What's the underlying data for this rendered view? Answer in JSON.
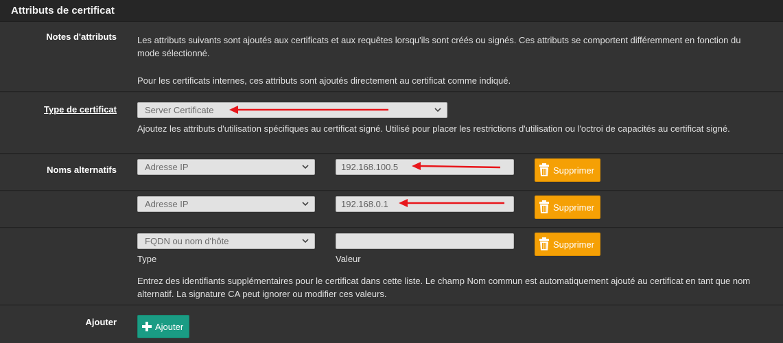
{
  "panel": {
    "title": "Attributs de certificat"
  },
  "notes": {
    "label": "Notes d'attributs",
    "text1": "Les attributs suivants sont ajoutés aux certificats et aux requêtes lorsqu'ils sont créés ou signés. Ces attributs se comportent différemment en fonction du mode sélectionné.",
    "text2": "Pour les certificats internes, ces attributs sont ajoutés directement au certificat comme indiqué."
  },
  "cert_type": {
    "label": "Type de certificat",
    "selected": "Server Certificate",
    "help": "Ajoutez les attributs d'utilisation spécifiques au certificat signé. Utilisé pour placer les restrictions d'utilisation ou l'octroi de capacités au certificat signé."
  },
  "alt_names": {
    "label": "Noms alternatifs",
    "rows": [
      {
        "type": "Adresse IP",
        "value": "192.168.100.5",
        "delete_label": "Supprimer"
      },
      {
        "type": "Adresse IP",
        "value": "192.168.0.1",
        "delete_label": "Supprimer"
      },
      {
        "type": "FQDN ou nom d'hôte",
        "value": "",
        "delete_label": "Supprimer"
      }
    ],
    "type_caption": "Type",
    "value_caption": "Valeur",
    "help": "Entrez des identifiants supplémentaires pour le certificat dans cette liste. Le champ Nom commun est automatiquement ajouté au certificat en tant que nom alternatif. La signature CA peut ignorer ou modifier ces valeurs."
  },
  "add": {
    "label": "Ajouter",
    "button_label": "Ajouter"
  },
  "icons": {
    "select": "chevron-down-icon",
    "delete": "trash-icon",
    "add": "plus-icon",
    "annotation": "red-arrow"
  },
  "colors": {
    "delete_button": "#f5a005",
    "add_button": "#1a9c84",
    "annotation_arrow": "#e8161b"
  }
}
